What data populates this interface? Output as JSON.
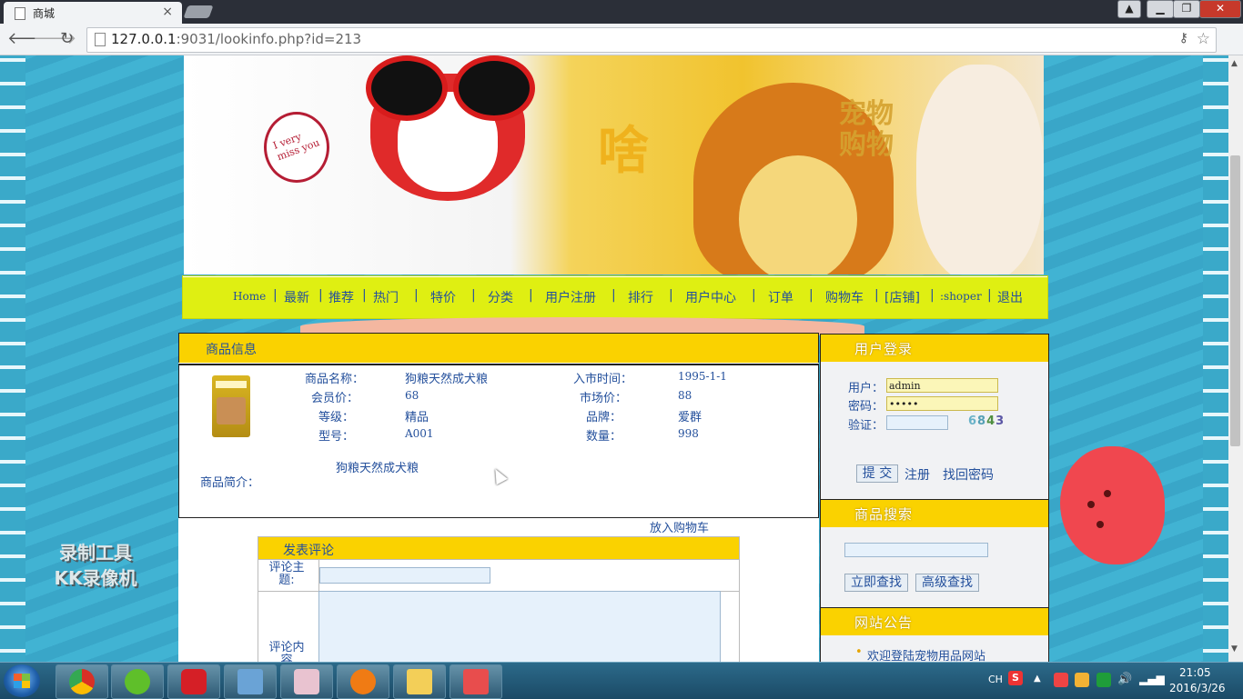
{
  "browser": {
    "tab_title": "商城",
    "tab_close": "×",
    "url_host": "127.0.0.1",
    "url_rest": ":9031/lookinfo.php?id=213"
  },
  "watermark": {
    "line1": "录制工具",
    "line2": "KK录像机"
  },
  "banner": {
    "bubble_text": "I very miss you",
    "sha": "啥",
    "pet_text_1": "宠物",
    "pet_text_2": "购物"
  },
  "nav": {
    "items": [
      "Home",
      "最新",
      "推荐",
      "热门",
      "特价",
      "分类",
      "用户注册",
      "排行",
      "用户中心",
      "订单",
      "购物车",
      "[店铺]",
      ":shoper",
      "退出"
    ]
  },
  "product": {
    "section_title": "商品信息",
    "name_label": "商品名称：",
    "name_value": "狗粮天然成犬粮",
    "launch_label": "入市时间：",
    "launch_value": "1995-1-1",
    "member_price_label": "会员价：",
    "member_price_value": "68",
    "market_price_label": "市场价：",
    "market_price_value": "88",
    "grade_label": "等级：",
    "grade_value": "精品",
    "brand_label": "品牌：",
    "brand_value": "爱群",
    "model_label": "型号：",
    "model_value": "A001",
    "quantity_label": "数量：",
    "quantity_value": "998",
    "intro_label": "商品简介：",
    "intro_value": "狗粮天然成犬粮",
    "add_to_cart": "放入购物车"
  },
  "comment": {
    "title": "发表评论",
    "subject_label": "评论主题:",
    "content_label": "评论内容",
    "subject_value": ""
  },
  "sidebar": {
    "login_title": "用户登录",
    "user_label": "用户：",
    "user_value": "admin",
    "password_label": "密码：",
    "password_value": "•••••",
    "verify_label": "验证：",
    "verify_value": "",
    "captcha": [
      "6",
      "8",
      "4",
      "3"
    ],
    "submit_label": "提 交",
    "register_label": "注册",
    "forgot_label": "找回密码",
    "search_title": "商品搜索",
    "search_value": "",
    "search_now_label": "立即查找",
    "advanced_search_label": "高级查找",
    "notice_title": "网站公告",
    "notice_item": "欢迎登陆宠物用品网站"
  },
  "taskbar": {
    "lang": "CH",
    "sogou": "S",
    "time": "21:05",
    "date": "2016/3/26"
  },
  "colors": {
    "nav_bg": "#dfef12",
    "section_yellow": "#fad200",
    "link_blue": "#24509c"
  }
}
